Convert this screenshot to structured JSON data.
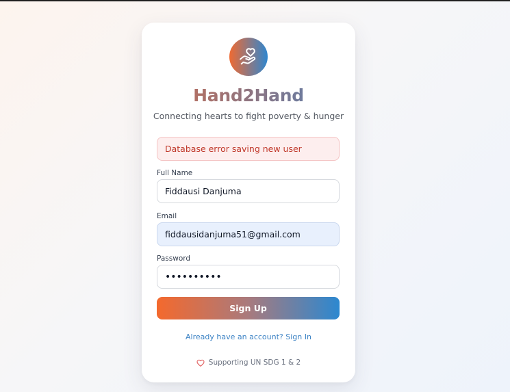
{
  "app": {
    "brand_name": "Hand2Hand",
    "tagline": "Connecting hearts to fight poverty & hunger"
  },
  "alert": {
    "message": "Database error saving new user"
  },
  "form": {
    "full_name": {
      "label": "Full Name",
      "value": "Fiddausi Danjuma"
    },
    "email": {
      "label": "Email",
      "value": "fiddausidanjuma51@gmail.com"
    },
    "password": {
      "label": "Password",
      "value": "••••••••••"
    },
    "submit_label": "Sign Up"
  },
  "signin_link": "Already have an account? Sign In",
  "footer": {
    "icon": "heart-icon",
    "text": "Supporting UN SDG 1 & 2"
  },
  "colors": {
    "brand_orange": "#f4692d",
    "brand_blue": "#2c88d0",
    "error_text": "#c0392b",
    "error_bg": "#fdeeee",
    "link": "#3b82c4"
  }
}
